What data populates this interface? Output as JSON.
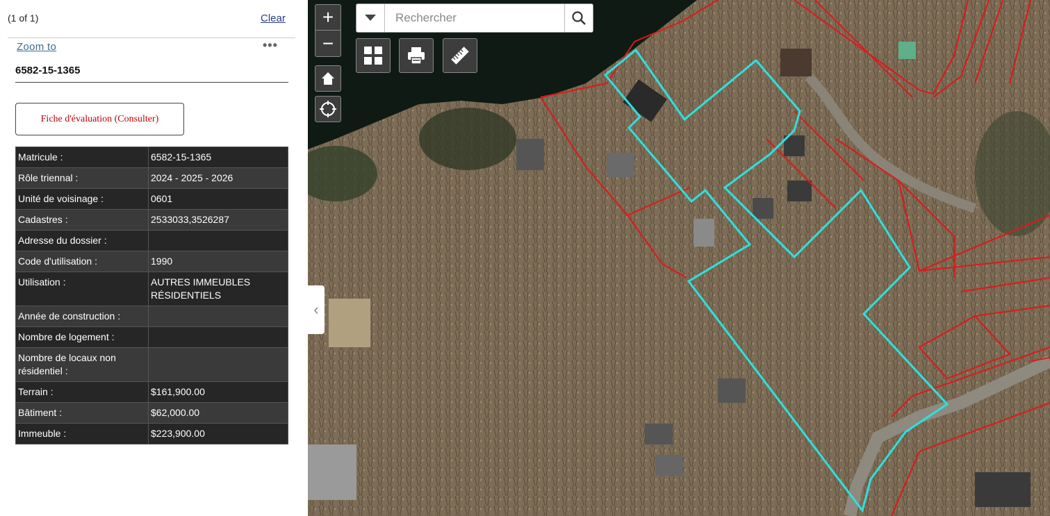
{
  "popup": {
    "pager": "(1 of 1)",
    "clear_label": "Clear",
    "zoom_to_label": "Zoom to",
    "more_label": "•••",
    "feature_title": "6582-15-1365",
    "fiche_button_label": "Fiche d'évaluation (Consulter)"
  },
  "attributes": [
    {
      "key": "Matricule :",
      "value": "6582-15-1365"
    },
    {
      "key": "Rôle triennal :",
      "value": "2024 - 2025 - 2026"
    },
    {
      "key": "Unité de voisinage :",
      "value": "0601"
    },
    {
      "key": "Cadastres :",
      "value": "2533033,3526287"
    },
    {
      "key": "Adresse du dossier :",
      "value": ""
    },
    {
      "key": "Code d'utilisation :",
      "value": "1990"
    },
    {
      "key": "Utilisation :",
      "value": "AUTRES IMMEUBLES RÉSIDENTIELS"
    },
    {
      "key": "Année de construction :",
      "value": ""
    },
    {
      "key": "Nombre de logement :",
      "value": ""
    },
    {
      "key": "Nombre de locaux non résidentiel :",
      "value": ""
    },
    {
      "key": "Terrain :",
      "value": "$161,900.00"
    },
    {
      "key": "Bâtiment :",
      "value": "$62,000.00"
    },
    {
      "key": "Immeuble :",
      "value": "$223,900.00"
    }
  ],
  "map": {
    "zoom_in_label": "+",
    "zoom_out_label": "−",
    "search_placeholder": "Rechercher",
    "collapse_glyph": "‹",
    "icons": [
      "chevron-down-icon",
      "search-icon",
      "home-icon",
      "locate-icon",
      "basemap-gallery-icon",
      "print-icon",
      "measure-icon"
    ],
    "colors": {
      "selected_parcel": "#2de0e0",
      "parcel_lines": "#e01818",
      "water": "#0f1a14",
      "ground": "#7a6a54",
      "widget_bg": "#3d3d3d"
    }
  }
}
